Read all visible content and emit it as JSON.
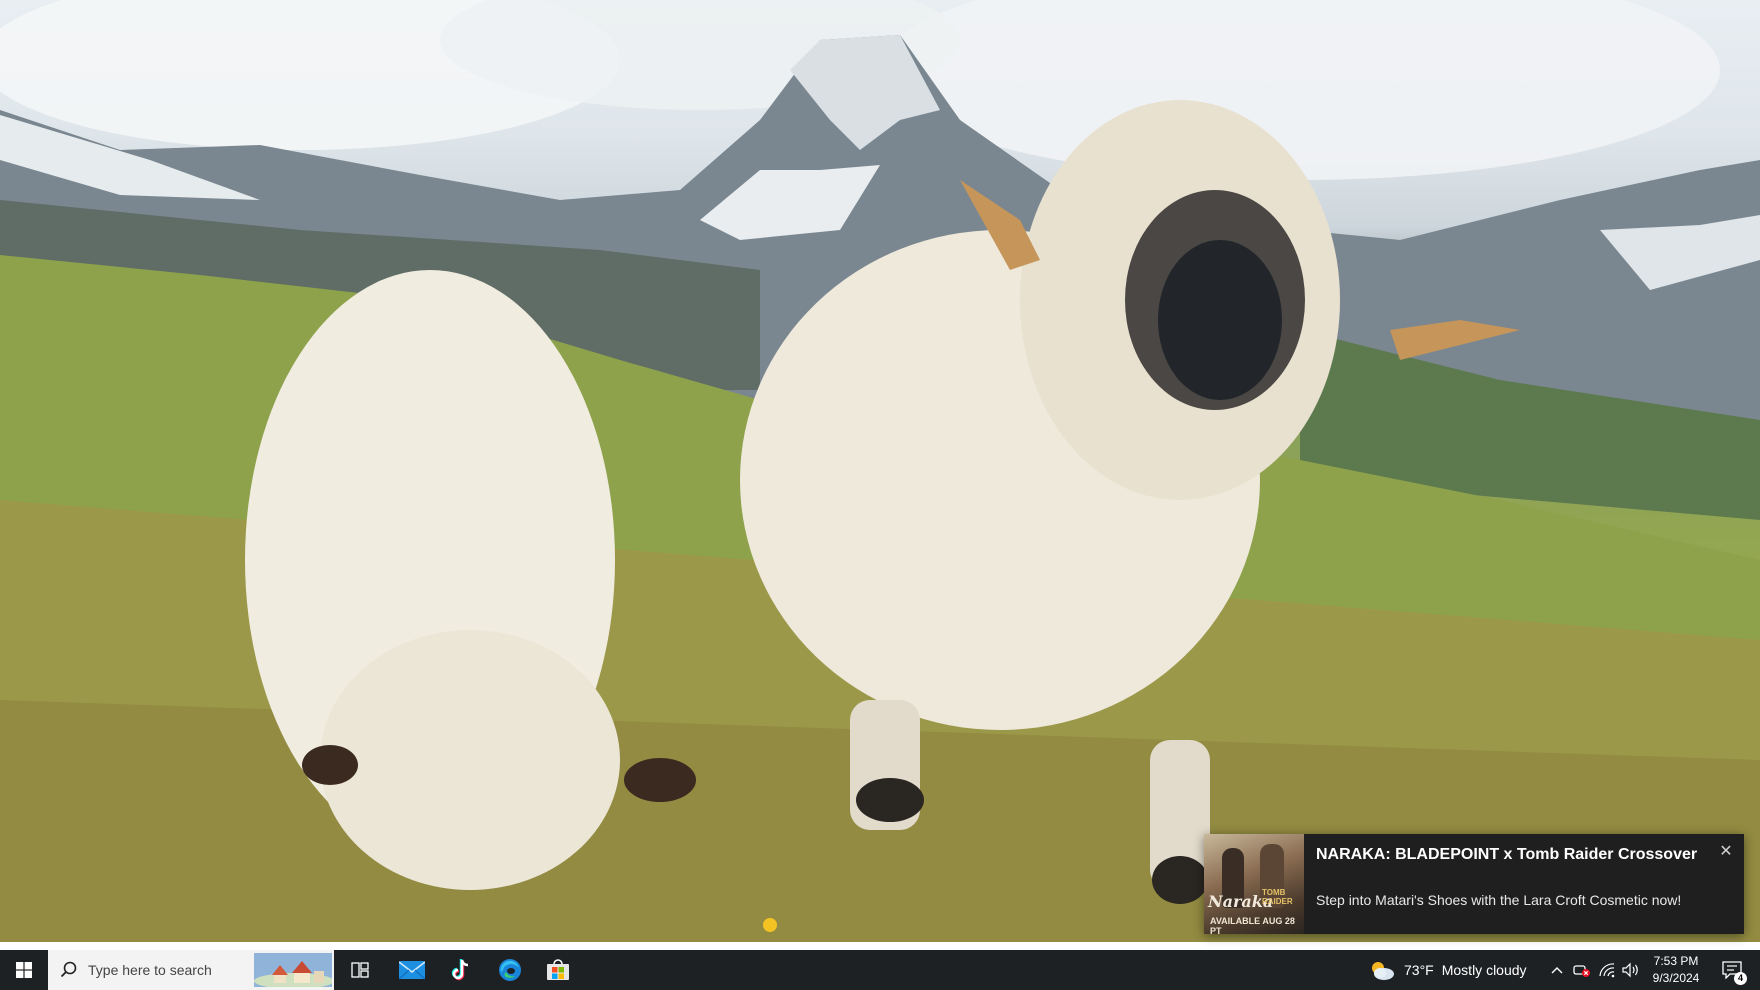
{
  "notification": {
    "title": "NARAKA: BLADEPOINT x Tomb Raider Crossover",
    "body": "Step into Matari's Shoes with the Lara Croft Cosmetic now!",
    "thumbnail": {
      "logo_left": "Naraka",
      "logo_right": "TOMB RAIDER",
      "caption": "AVAILABLE AUG 28 PT"
    },
    "close_icon": "close-icon"
  },
  "taskbar": {
    "search_placeholder": "Type here to search",
    "apps": [
      {
        "name": "Task View",
        "icon": "task-view-icon"
      },
      {
        "name": "Mail",
        "icon": "mail-icon"
      },
      {
        "name": "TikTok",
        "icon": "tiktok-icon"
      },
      {
        "name": "Microsoft Edge",
        "icon": "edge-icon"
      },
      {
        "name": "Microsoft Store",
        "icon": "store-icon"
      }
    ],
    "weather": {
      "temperature": "73°F",
      "condition": "Mostly cloudy",
      "icon": "cloud-sun-icon"
    },
    "tray": {
      "icons": [
        "chevron-up-icon",
        "meet-now-icon",
        "network-icon",
        "volume-icon"
      ]
    },
    "clock": {
      "time": "7:53 PM",
      "date": "9/3/2024"
    },
    "notifications": {
      "count": "4",
      "icon": "action-center-icon"
    }
  },
  "colors": {
    "taskbar_bg": "#1e2124",
    "toast_bg": "#1f1f1f",
    "search_bg": "#f3f3f3",
    "accent": "#76b9ed"
  }
}
